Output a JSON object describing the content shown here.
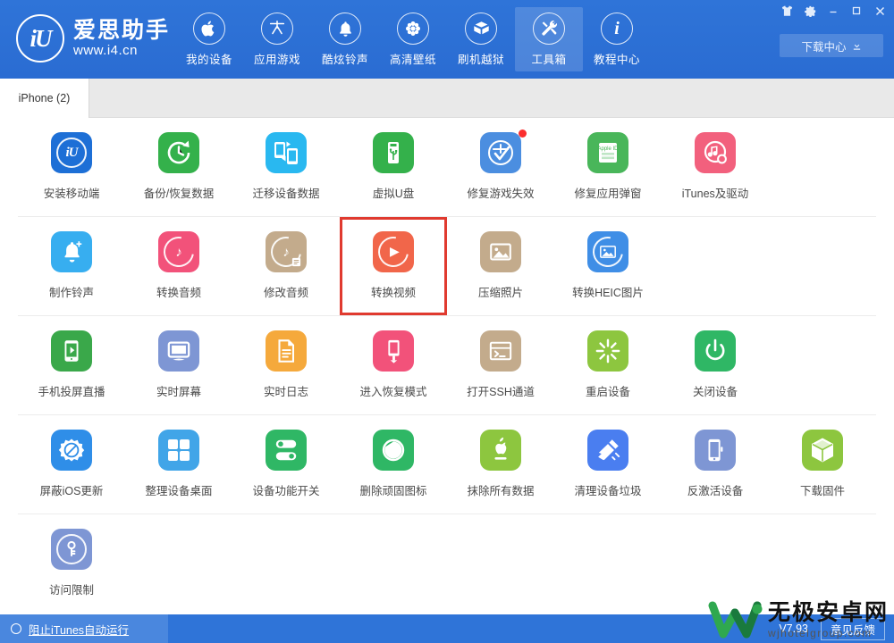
{
  "app": {
    "logo_mark": "iU",
    "logo_title": "爱思助手",
    "logo_url": "www.i4.cn"
  },
  "header": {
    "nav": [
      {
        "label": "我的设备",
        "icon": "apple-icon",
        "active": false
      },
      {
        "label": "应用游戏",
        "icon": "appstore-icon",
        "active": false
      },
      {
        "label": "酷炫铃声",
        "icon": "bell-icon",
        "active": false
      },
      {
        "label": "高清壁纸",
        "icon": "flower-icon",
        "active": false
      },
      {
        "label": "刷机越狱",
        "icon": "openbox-icon",
        "active": false
      },
      {
        "label": "工具箱",
        "icon": "tools-icon",
        "active": true
      },
      {
        "label": "教程中心",
        "icon": "info-icon",
        "active": false
      }
    ],
    "window_controls": [
      {
        "name": "skin-icon",
        "glyph": "👕"
      },
      {
        "name": "settings-gear-icon",
        "glyph": "⚙"
      },
      {
        "name": "minimize-icon",
        "glyph": "—"
      },
      {
        "name": "maximize-icon",
        "glyph": "▫"
      },
      {
        "name": "close-icon",
        "glyph": "✕"
      }
    ],
    "download_center": {
      "label": "下载中心",
      "icon": "download-arrow-icon"
    }
  },
  "tabs": [
    {
      "label": "iPhone (2)",
      "active": true
    }
  ],
  "toolbox": {
    "rows": [
      [
        {
          "label": "安装移动端",
          "icon": "i4-app-icon",
          "color": "#1d6fd6",
          "glyph": "iU",
          "badge": false
        },
        {
          "label": "备份/恢复数据",
          "icon": "backup-restore-icon",
          "color": "#34b14b",
          "glyph": "↺",
          "badge": false
        },
        {
          "label": "迁移设备数据",
          "icon": "migrate-data-icon",
          "color": "#29b8f0",
          "glyph": "⇄",
          "badge": false
        },
        {
          "label": "虚拟U盘",
          "icon": "usb-drive-icon",
          "color": "#34b14b",
          "glyph": "⑂",
          "badge": false
        },
        {
          "label": "修复游戏失效",
          "icon": "fix-game-icon",
          "color": "#4b8ee0",
          "glyph": "✓",
          "badge": true
        },
        {
          "label": "修复应用弹窗",
          "icon": "appleid-fix-icon",
          "color": "#49b65a",
          "glyph": "ID",
          "badge": false
        },
        {
          "label": "iTunes及驱动",
          "icon": "itunes-driver-icon",
          "color": "#f2607d",
          "glyph": "♪",
          "badge": false
        }
      ],
      [
        {
          "label": "制作铃声",
          "icon": "make-ringtone-icon",
          "color": "#37aef0",
          "glyph": "🔔",
          "badge": false
        },
        {
          "label": "转换音频",
          "icon": "convert-audio-icon",
          "color": "#f2527a",
          "glyph": "♪",
          "badge": false
        },
        {
          "label": "修改音频",
          "icon": "edit-audio-icon",
          "color": "#c3ab8c",
          "glyph": "♪",
          "badge": false
        },
        {
          "label": "转换视频",
          "icon": "convert-video-icon",
          "color": "#f1664a",
          "glyph": "▶",
          "badge": false,
          "selected": true
        },
        {
          "label": "压缩照片",
          "icon": "compress-photo-icon",
          "color": "#c3ab8c",
          "glyph": "🖼",
          "badge": false
        },
        {
          "label": "转换HEIC图片",
          "icon": "convert-heic-icon",
          "color": "#3f8ee6",
          "glyph": "🖼",
          "badge": false
        }
      ],
      [
        {
          "label": "手机投屏直播",
          "icon": "screen-cast-icon",
          "color": "#3aa84a",
          "glyph": "▶",
          "badge": false
        },
        {
          "label": "实时屏幕",
          "icon": "live-screen-icon",
          "color": "#7e96d4",
          "glyph": "🖵",
          "badge": false
        },
        {
          "label": "实时日志",
          "icon": "live-log-icon",
          "color": "#f5a93c",
          "glyph": "📄",
          "badge": false
        },
        {
          "label": "进入恢复模式",
          "icon": "recovery-mode-icon",
          "color": "#f2527a",
          "glyph": "📱",
          "badge": false
        },
        {
          "label": "打开SSH通道",
          "icon": "ssh-tunnel-icon",
          "color": "#c3ab8c",
          "glyph": ">_",
          "badge": false
        },
        {
          "label": "重启设备",
          "icon": "restart-device-icon",
          "color": "#8dc63f",
          "glyph": "✳",
          "badge": false
        },
        {
          "label": "关闭设备",
          "icon": "shutdown-icon",
          "color": "#2fb765",
          "glyph": "⏻",
          "badge": false
        }
      ],
      [
        {
          "label": "屏蔽iOS更新",
          "icon": "block-ios-update-icon",
          "color": "#2f8ee8",
          "glyph": "⚙",
          "badge": false
        },
        {
          "label": "整理设备桌面",
          "icon": "arrange-desktop-icon",
          "color": "#41a5e8",
          "glyph": "▦",
          "badge": false
        },
        {
          "label": "设备功能开关",
          "icon": "feature-toggle-icon",
          "color": "#2fb765",
          "glyph": "⊜",
          "badge": false
        },
        {
          "label": "删除顽固图标",
          "icon": "remove-icon-icon",
          "color": "#2fb765",
          "glyph": "◕",
          "badge": false
        },
        {
          "label": "抹除所有数据",
          "icon": "erase-data-icon",
          "color": "#8dc63f",
          "glyph": "",
          "badge": false
        },
        {
          "label": "清理设备垃圾",
          "icon": "clean-junk-icon",
          "color": "#4a7ef0",
          "glyph": "🧹",
          "badge": false
        },
        {
          "label": "反激活设备",
          "icon": "deactivate-icon",
          "color": "#7e96d4",
          "glyph": "📱",
          "badge": false
        },
        {
          "label": "下载固件",
          "icon": "download-firmware-icon",
          "color": "#8dc63f",
          "glyph": "⬡",
          "badge": false
        }
      ],
      [
        {
          "label": "访问限制",
          "icon": "access-restrict-icon",
          "color": "#7e96d4",
          "glyph": "🔑",
          "badge": false
        }
      ]
    ]
  },
  "statusbar": {
    "block_itunes_label": "阻止iTunes自动运行",
    "version": "V7.93",
    "feedback_label": "意见反馈"
  },
  "watermark": {
    "title": "无极安卓网",
    "url": "wjhotelgroup.com"
  }
}
